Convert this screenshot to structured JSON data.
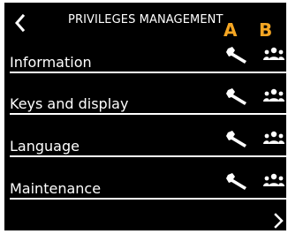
{
  "header": {
    "title": "PRIVILEGES MANAGEMENT",
    "column_a_label": "A",
    "column_b_label": "B"
  },
  "rows": [
    {
      "label": "Information"
    },
    {
      "label": "Keys and display"
    },
    {
      "label": "Language"
    },
    {
      "label": "Maintenance"
    }
  ],
  "colors": {
    "background": "#000000",
    "text": "#ffffff",
    "accent": "#f5a623"
  },
  "icons": {
    "back": "chevron-left-icon",
    "next": "chevron-right-icon",
    "column_a": "wrench-icon",
    "column_b": "users-icon"
  }
}
